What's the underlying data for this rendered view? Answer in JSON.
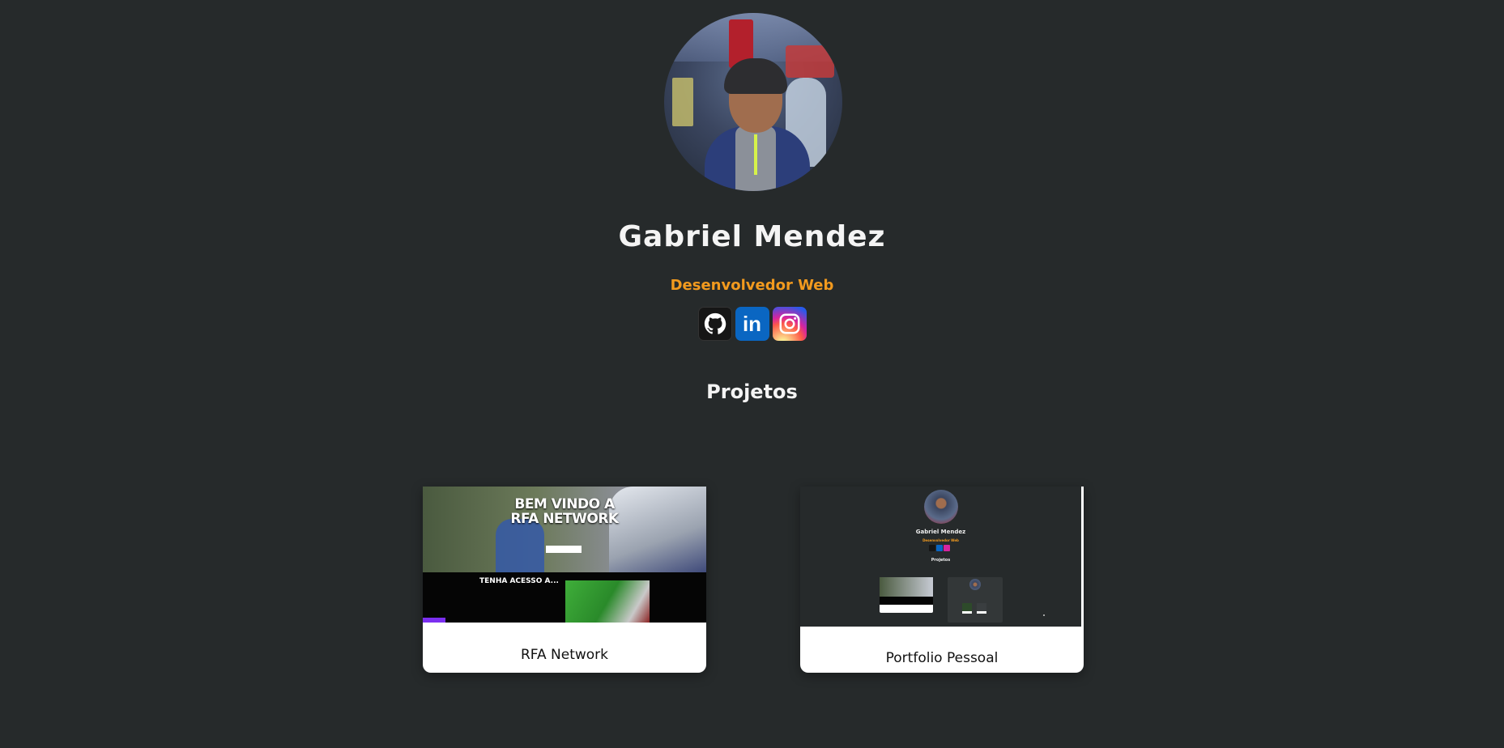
{
  "profile": {
    "name": "Gabriel Mendez",
    "role": "Desenvolvedor Web"
  },
  "socials": [
    {
      "name": "GitHub",
      "icon": "github-icon",
      "color": "#161616"
    },
    {
      "name": "LinkedIn",
      "icon": "linkedin-icon",
      "color": "#0a66c2",
      "glyph": "in"
    },
    {
      "name": "Instagram",
      "icon": "instagram-icon",
      "color": "#d6249f"
    }
  ],
  "projects": {
    "title": "Projetos",
    "items": [
      {
        "label": "RFA Network",
        "preview": {
          "hero_title_line1": "BEM VINDO A",
          "hero_title_line2": "RFA NETWORK",
          "section_title": "TENHA ACESSO A..."
        }
      },
      {
        "label": "Portfolio Pessoal",
        "preview": {
          "name": "Gabriel Mendez",
          "role": "Desenvolvedor Web",
          "section_title": "Projetos"
        }
      }
    ]
  },
  "theme": {
    "background": "#262a2b",
    "accent": "#f29a1e",
    "text": "#f4f4f4"
  }
}
